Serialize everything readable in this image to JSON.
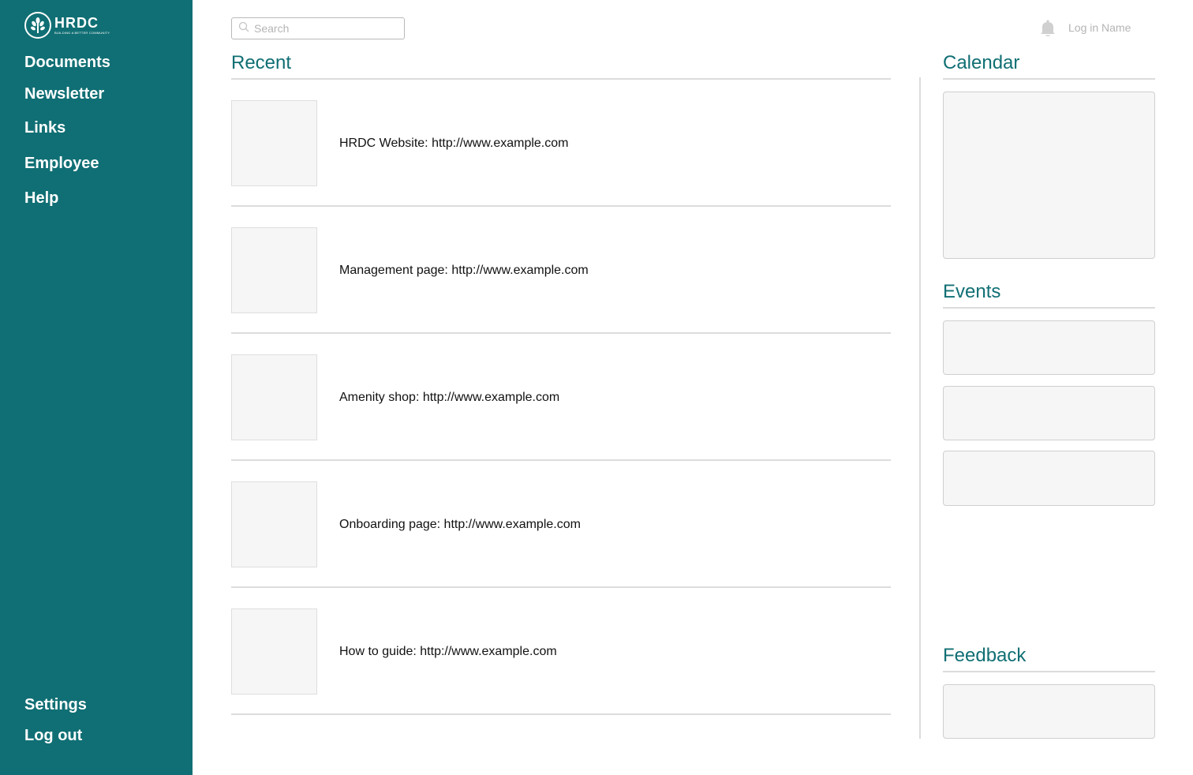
{
  "brand": {
    "name": "HRDC",
    "tagline": "BUILDING A BETTER COMMUNITY"
  },
  "sidebar": {
    "items": [
      {
        "label": "Documents"
      },
      {
        "label": "Newsletter"
      },
      {
        "label": "Links"
      },
      {
        "label": "Employee"
      },
      {
        "label": "Help"
      }
    ],
    "bottom_items": [
      {
        "label": "Settings"
      },
      {
        "label": "Log out"
      }
    ]
  },
  "header": {
    "search_placeholder": "Search",
    "login_name": "Log in Name",
    "icons": [
      "search-icon",
      "bell-icon"
    ]
  },
  "recent": {
    "title": "Recent",
    "items": [
      {
        "text": "HRDC Website: http://www.example.com"
      },
      {
        "text": "Management page: http://www.example.com"
      },
      {
        "text": "Amenity shop: http://www.example.com"
      },
      {
        "text": "Onboarding page: http://www.example.com"
      },
      {
        "text": "How to guide: http://www.example.com"
      }
    ]
  },
  "calendar": {
    "title": "Calendar"
  },
  "events": {
    "title": "Events"
  },
  "feedback": {
    "title": "Feedback"
  },
  "colors": {
    "brand": "#106f74",
    "panel": "#f6f6f6",
    "divider": "#dcdcdc"
  }
}
